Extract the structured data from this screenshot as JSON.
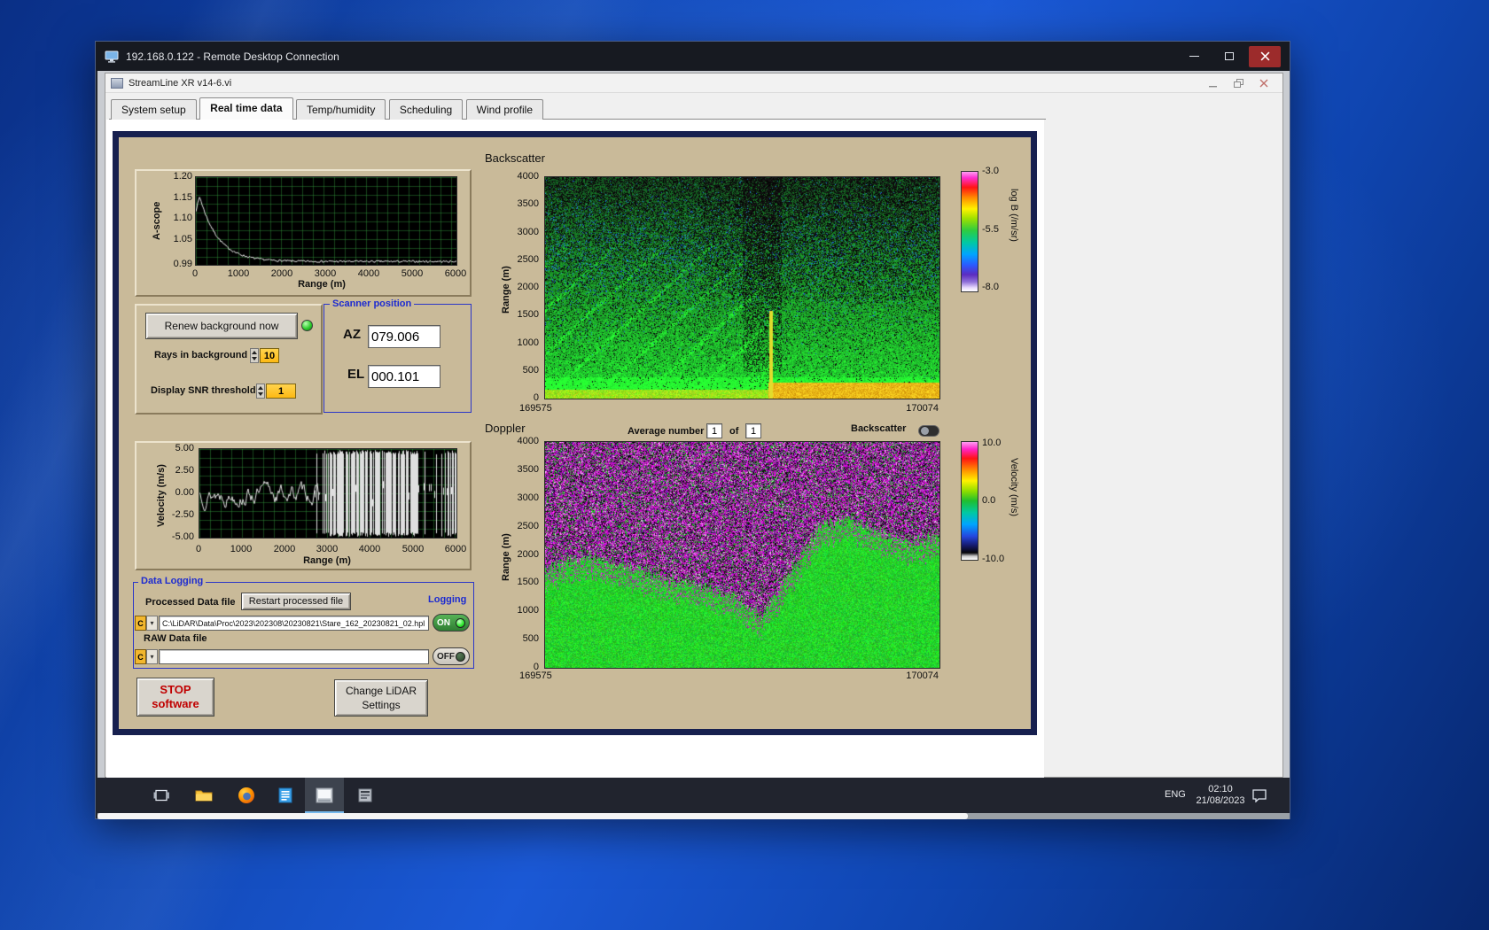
{
  "rdp": {
    "title": "192.168.0.122 - Remote Desktop Connection"
  },
  "app": {
    "title": "StreamLine XR v14-6.vi",
    "tabs": [
      "System setup",
      "Real time data",
      "Temp/humidity",
      "Scheduling",
      "Wind profile"
    ]
  },
  "ascope": {
    "ylabel": "A-scope",
    "xlabel": "Range (m)",
    "yticks": [
      "1.20",
      "1.15",
      "1.10",
      "1.05",
      "0.99"
    ],
    "xticks": [
      "0",
      "1000",
      "2000",
      "3000",
      "4000",
      "5000",
      "6000"
    ]
  },
  "background_controls": {
    "renew_button": "Renew background now",
    "rays_label": "Rays in background",
    "rays_value": "10",
    "snr_label": "Display SNR threshold",
    "snr_value": "1"
  },
  "scanner": {
    "title": "Scanner position",
    "az_label": "AZ",
    "az_value": "079.006",
    "el_label": "EL",
    "el_value": "000.101"
  },
  "backscatter": {
    "title": "Backscatter",
    "ylabel": "Range (m)",
    "yticks": [
      "4000",
      "3500",
      "3000",
      "2500",
      "2000",
      "1500",
      "1000",
      "500",
      "0"
    ],
    "x_start": "169575",
    "x_end": "170074",
    "cb_ticks": [
      "-3.0",
      "-5.5",
      "-8.0"
    ],
    "cb_label": "log B (/m/sr)"
  },
  "doppler": {
    "title": "Doppler",
    "avg_label": "Average number",
    "avg_value": "1",
    "of_label": "of",
    "of_value": "1",
    "toggle_label": "Backscatter",
    "ylabel": "Range (m)",
    "yticks": [
      "4000",
      "3500",
      "3000",
      "2500",
      "2000",
      "1500",
      "1000",
      "500",
      "0"
    ],
    "x_start": "169575",
    "x_end": "170074",
    "cb_ticks": [
      "10.0",
      "0.0",
      "-10.0"
    ],
    "cb_label": "Velocity (m/s)"
  },
  "velocity": {
    "ylabel": "Velocity (m/s)",
    "xlabel": "Range (m)",
    "yticks": [
      "5.00",
      "2.50",
      "0.00",
      "-2.50",
      "-5.00"
    ],
    "xticks": [
      "0",
      "1000",
      "2000",
      "3000",
      "4000",
      "5000",
      "6000"
    ]
  },
  "logging": {
    "title": "Data Logging",
    "processed_label": "Processed Data file",
    "restart_button": "Restart processed file",
    "logging_label": "Logging",
    "drive_c": "C",
    "processed_path": "C:\\LiDAR\\Data\\Proc\\2023\\202308\\20230821\\Stare_162_20230821_02.hpl",
    "on_label": "ON",
    "raw_label": "RAW Data file",
    "raw_path": "",
    "off_label": "OFF"
  },
  "actions": {
    "stop_line1": "STOP",
    "stop_line2": "software",
    "settings_line1": "Change LiDAR",
    "settings_line2": "Settings"
  },
  "taskbar": {
    "lang": "ENG",
    "time": "02:10",
    "date": "21/08/2023"
  },
  "colors": {
    "panel_tan": "#c9ba99",
    "frame_navy": "#17204f",
    "label_blue": "#1d2bd0",
    "led_green": "#2ecc2e",
    "field_yellow": "#fdb913"
  }
}
